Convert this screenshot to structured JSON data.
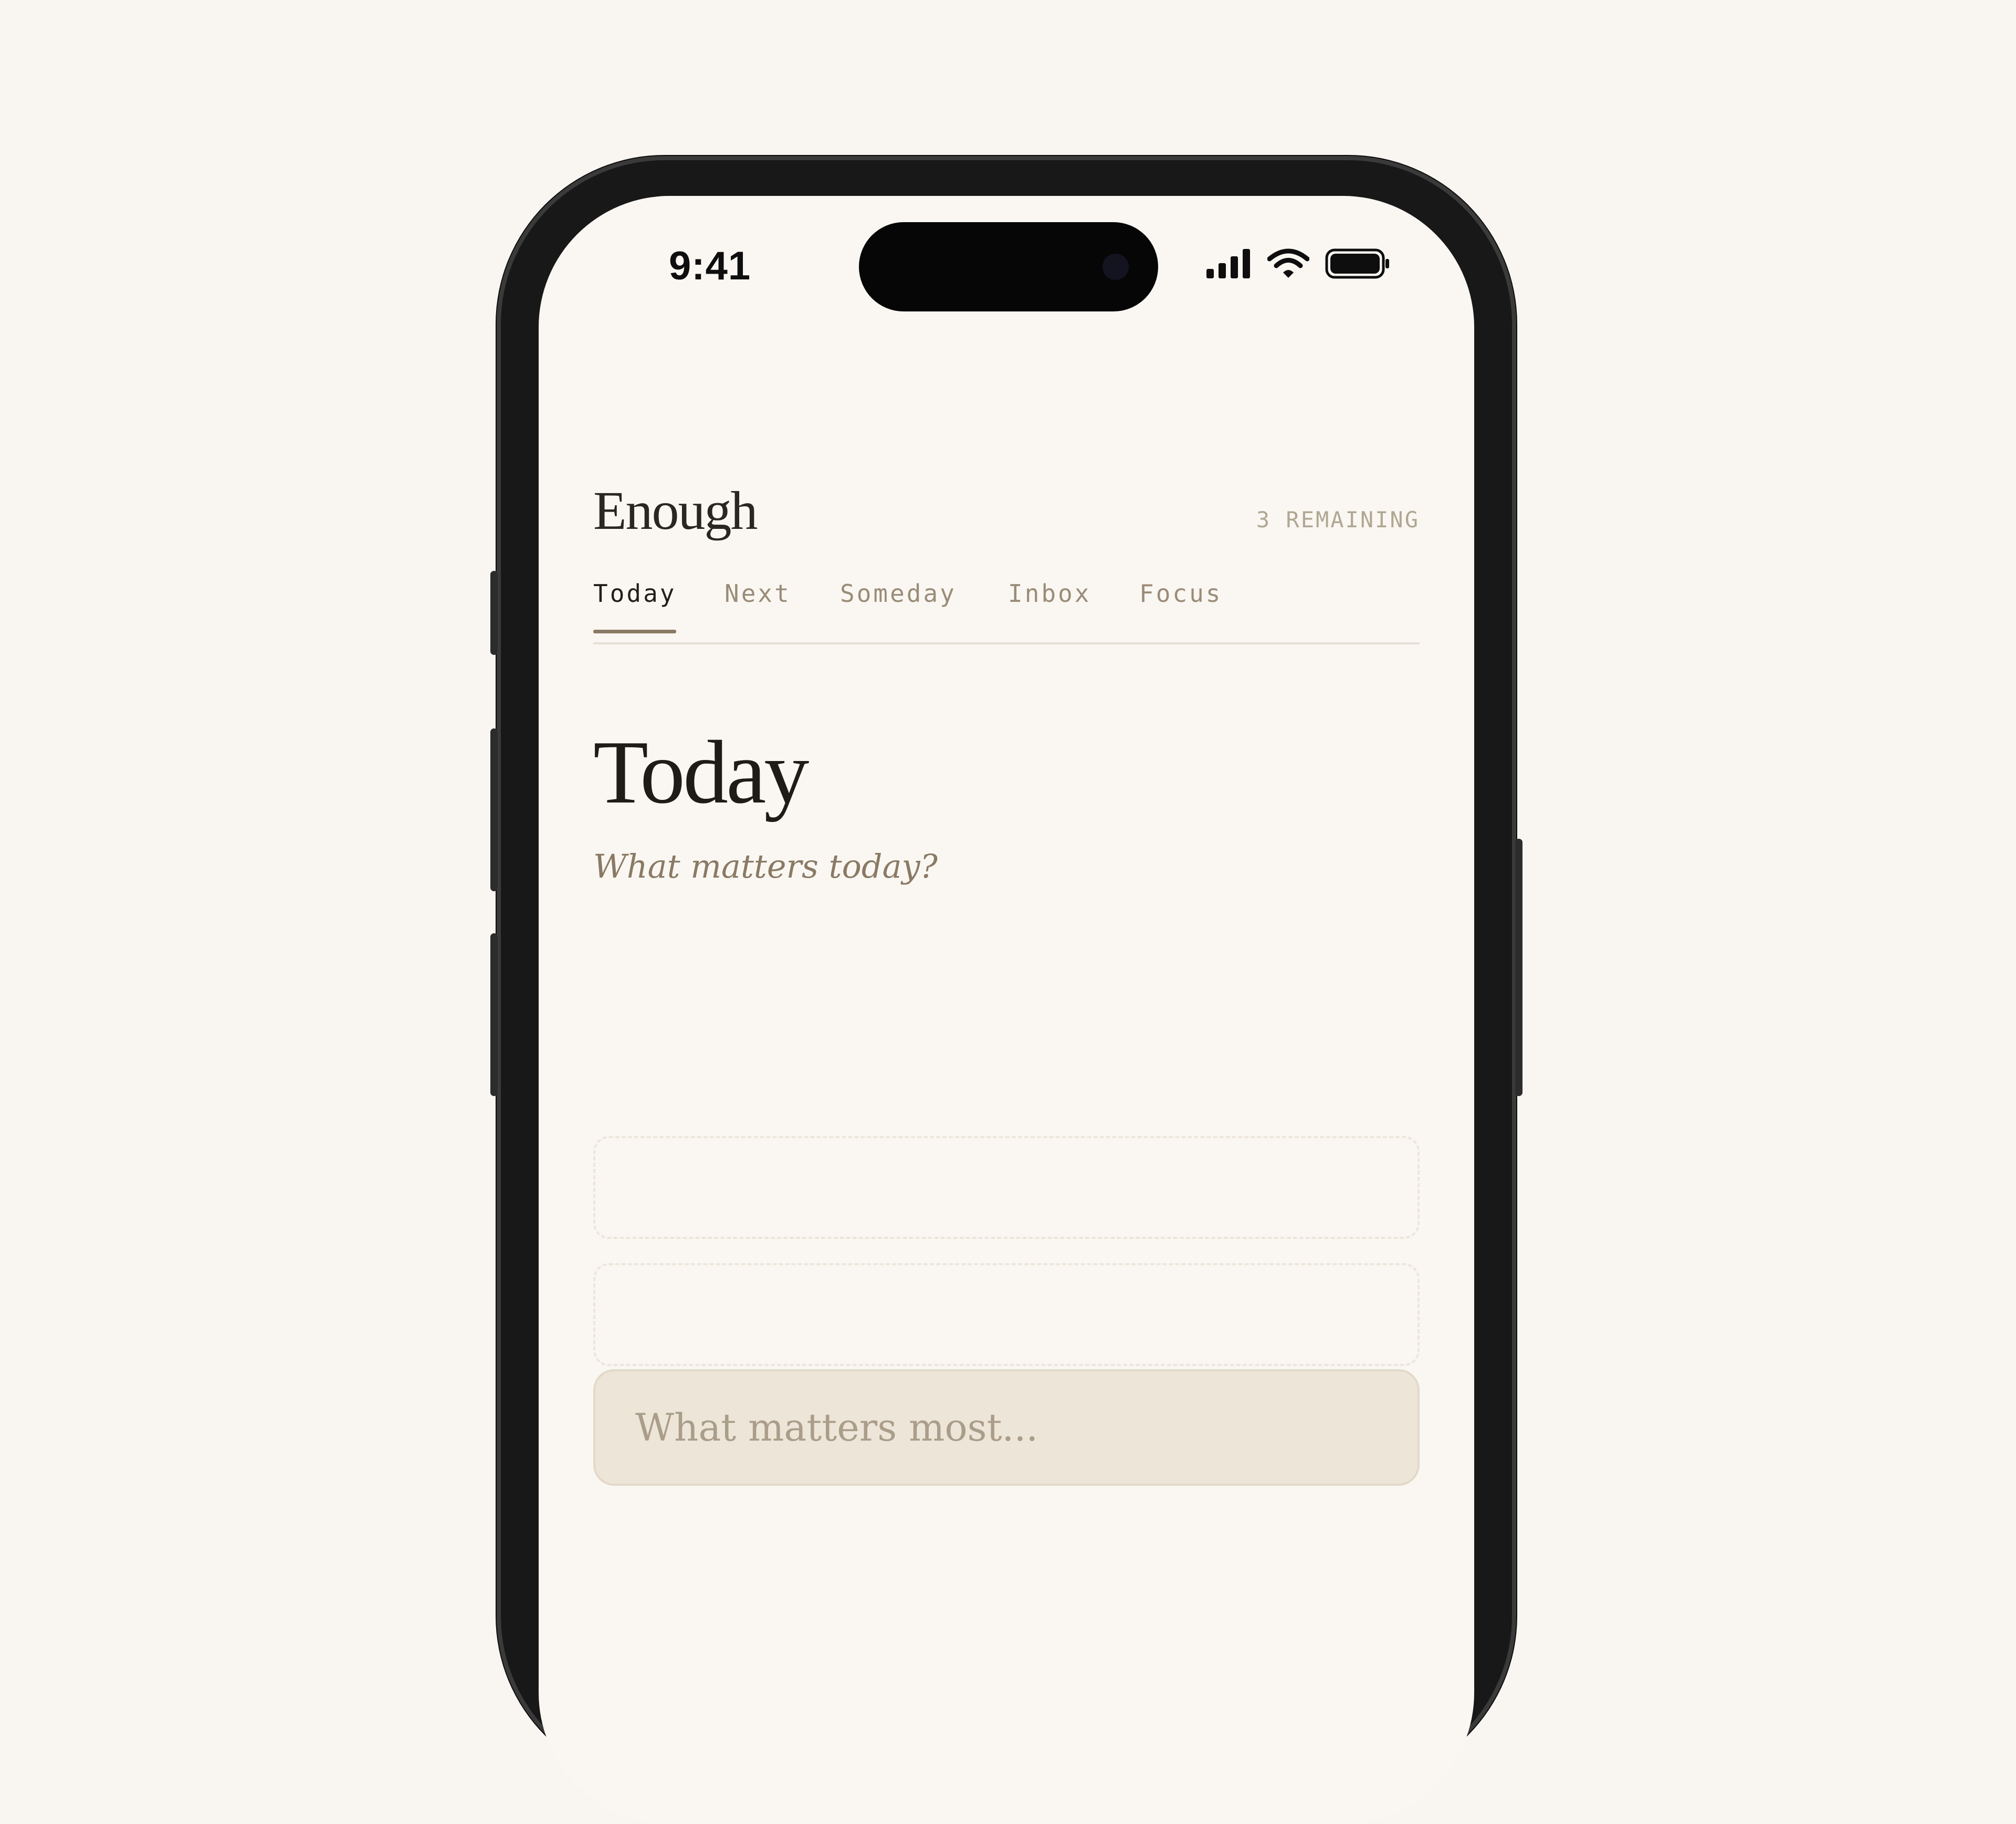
{
  "status_bar": {
    "time": "9:41",
    "icons": [
      "cellular-signal-icon",
      "wifi-icon",
      "battery-icon"
    ]
  },
  "header": {
    "app_name": "Enough",
    "remaining": "3 REMAINING"
  },
  "tabs": [
    {
      "label": "Today",
      "active": true
    },
    {
      "label": "Next",
      "active": false
    },
    {
      "label": "Someday",
      "active": false
    },
    {
      "label": "Inbox",
      "active": false
    },
    {
      "label": "Focus",
      "active": false
    }
  ],
  "main": {
    "title": "Today",
    "subtitle": "What matters today?",
    "empty_slots": 3
  },
  "entry": {
    "placeholder": "What matters most...",
    "value": ""
  },
  "colors": {
    "background": "#f9f6f1",
    "accent": "#8a7a65",
    "input_fill": "#ede5d8"
  }
}
